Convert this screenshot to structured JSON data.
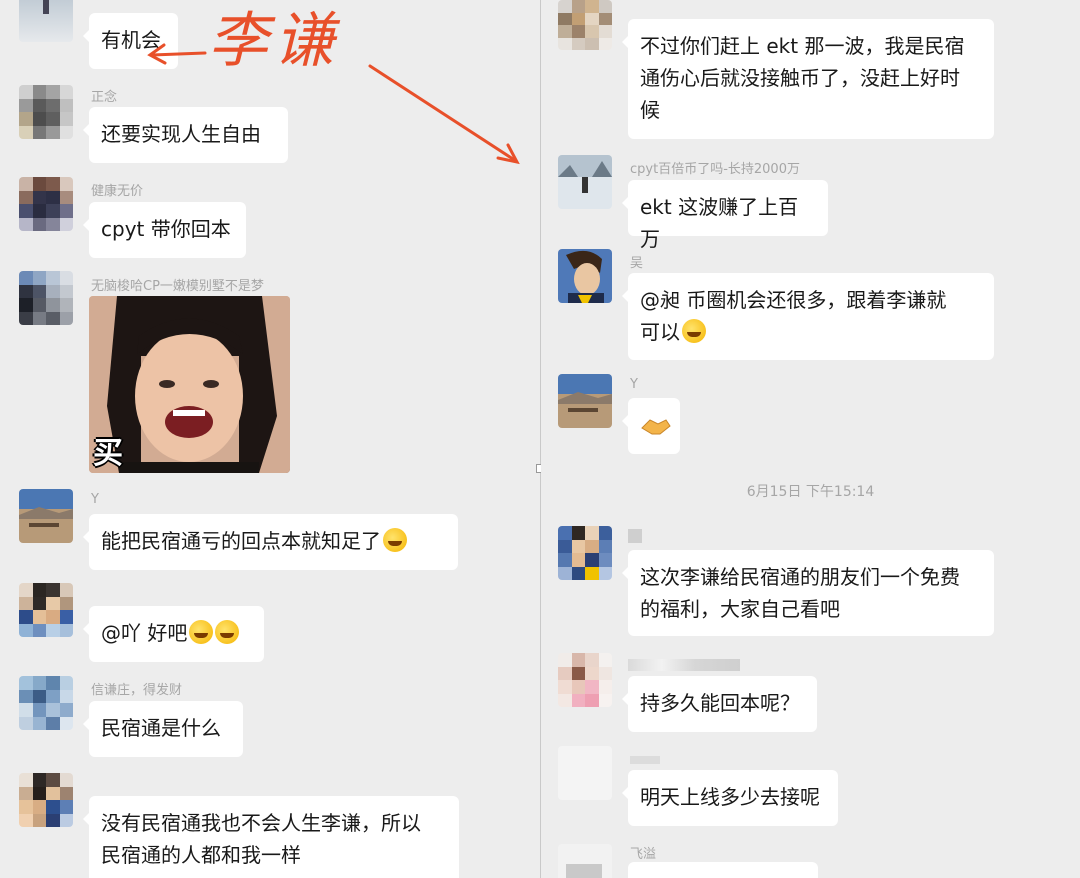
{
  "colors": {
    "chat_bg": "#ededed",
    "bubble_bg": "#ffffff",
    "annotation": "#e8502a"
  },
  "annotation": {
    "text": "李谦",
    "arrow_left_icon": "arrow-left-icon",
    "arrow_down_right_icon": "arrow-down-right-icon"
  },
  "left_panel": {
    "messages": [
      {
        "sender": "",
        "text": "有机会"
      },
      {
        "sender": "正念",
        "text": "还要实现人生自由"
      },
      {
        "sender": "健康无价",
        "text": "cpyt 带你回本"
      },
      {
        "sender": "无脑梭哈CP一嫩模别墅不是梦",
        "image_caption": "买"
      },
      {
        "sender": "Y",
        "text": "能把民宿通亏的回点本就知足了"
      },
      {
        "sender": "",
        "text": "@吖 好吧"
      },
      {
        "sender": "信谦庄，得发财",
        "text": "民宿通是什么"
      },
      {
        "sender": "",
        "text_line1": "没有民宿通我也不会人生李谦，所以",
        "text_line2": "民宿通的人都和我一样"
      }
    ]
  },
  "right_panel": {
    "messages": [
      {
        "sender": "",
        "text_line1": "不过你们赶上 ekt 那一波，我是民宿",
        "text_line2": "通伤心后就没接触币了，没赶上好时",
        "text_line3": "候"
      },
      {
        "sender": "cpyt百倍币了吗-长持2000万",
        "text": "ekt 这波赚了上百万"
      },
      {
        "sender": "吴",
        "text_line1": "@昶  币圈机会还很多，跟着李谦就",
        "text_line2": "可以"
      },
      {
        "sender": "Y",
        "emoji": "handshake-icon"
      },
      {
        "sender": "",
        "text_line1": "这次李谦给民宿通的朋友们一个免费",
        "text_line2": "的福利，大家自己看吧"
      },
      {
        "sender": "",
        "text": "持多久能回本呢？"
      },
      {
        "sender": "",
        "text": "明天上线多少去接呢"
      },
      {
        "sender": "飞溢"
      }
    ],
    "timestamp": "6月15日 下午15:14"
  }
}
